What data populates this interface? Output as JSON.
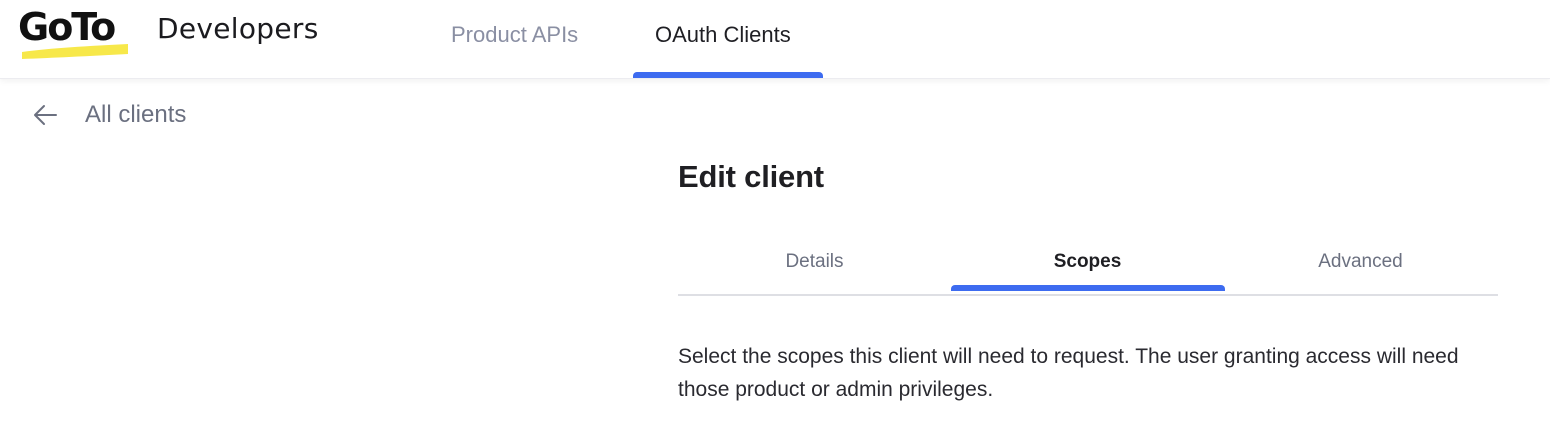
{
  "header": {
    "logo_text": "GoTo",
    "brand": "Developers",
    "nav": [
      {
        "label": "Product APIs",
        "active": false
      },
      {
        "label": "OAuth Clients",
        "active": true
      }
    ]
  },
  "back_link": {
    "label": "All clients",
    "icon": "arrow-left-icon"
  },
  "main": {
    "title": "Edit client",
    "tabs": [
      {
        "label": "Details",
        "active": false
      },
      {
        "label": "Scopes",
        "active": true
      },
      {
        "label": "Advanced",
        "active": false
      }
    ],
    "description": "Select the scopes this client will need to request. The user granting access will need those product or admin privileges."
  },
  "colors": {
    "accent": "#3d6bf0",
    "logo_highlight": "#f7e84a",
    "muted_text": "#8a8fa3"
  }
}
